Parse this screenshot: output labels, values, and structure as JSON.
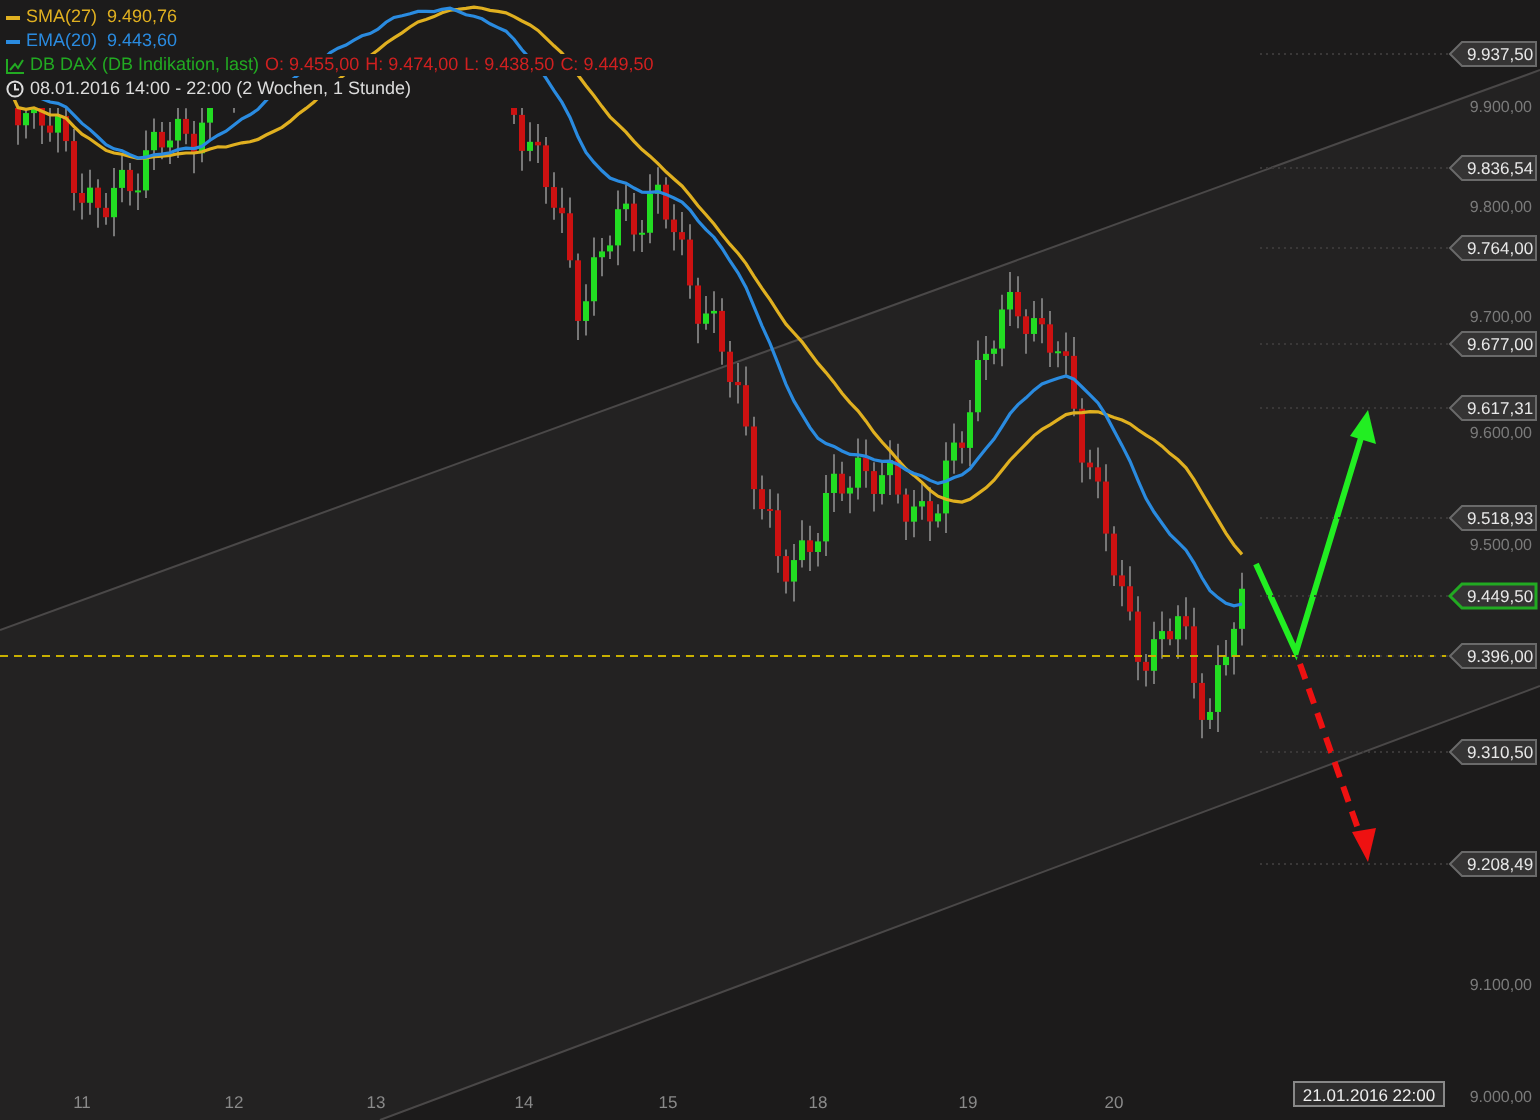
{
  "legend": [
    {
      "label": "SMA(27)",
      "value": "9.490,76",
      "color": "#e0b020"
    },
    {
      "label": "EMA(20)",
      "value": "9.443,60",
      "color": "#2a8be0"
    }
  ],
  "instrument": {
    "name": "DB DAX (DB Indikation, last)",
    "quotes": [
      "O: 9.455,00",
      "H: 9.474,00",
      "L: 9.438,50",
      "C: 9.449,50"
    ]
  },
  "time_range": "08.01.2016 14:00 - 22:00 (2 Wochen, 1 Stunde)",
  "price_labels": [
    {
      "text": "9.937,50",
      "kind": "level"
    },
    {
      "text": "9.836,54",
      "kind": "level"
    },
    {
      "text": "9.764,00",
      "kind": "level"
    },
    {
      "text": "9.677,00",
      "kind": "level"
    },
    {
      "text": "9.617,31",
      "kind": "level"
    },
    {
      "text": "9.518,93",
      "kind": "level"
    },
    {
      "text": "9.449,50",
      "kind": "last"
    },
    {
      "text": "9.396,00",
      "kind": "level"
    },
    {
      "text": "9.310,50",
      "kind": "level"
    },
    {
      "text": "9.208,49",
      "kind": "level"
    }
  ],
  "y_ticks": [
    "9.900,00",
    "9.800,00",
    "9.700,00",
    "9.600,00",
    "9.500,00",
    "9.100,00",
    "9.000,00"
  ],
  "x_ticks": [
    "11",
    "12",
    "13",
    "14",
    "15",
    "18",
    "19",
    "20"
  ],
  "cursor_date": "21.01.2016 22:00"
}
